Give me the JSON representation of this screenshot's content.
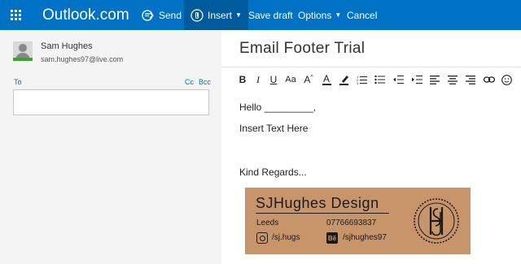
{
  "topbar": {
    "brand": "Outlook.com",
    "send_label": "Send",
    "insert_label": "Insert",
    "save_draft_label": "Save draft",
    "options_label": "Options",
    "cancel_label": "Cancel",
    "accent": "#0072c6"
  },
  "sender": {
    "name": "Sam Hughes",
    "email": "sam.hughes97@live.com"
  },
  "recipients": {
    "to_label": "To",
    "cc_label": "Cc",
    "bcc_label": "Bcc",
    "to_value": ""
  },
  "message": {
    "subject": "Email Footer Trial",
    "lines": [
      "Hello _________,",
      "Insert Text Here",
      "Kind Regards..."
    ]
  },
  "toolbar": {
    "bold": "B",
    "italic": "I",
    "underline": "U",
    "font_size": "Aa",
    "grow": "A",
    "font_color": "A"
  },
  "signature": {
    "title": "SJHughes Design",
    "city": "Leeds",
    "phone": "07766693837",
    "instagram": "/sj.hugs",
    "behance": "/sjhughes97",
    "behance_icon_text": "Bē",
    "seal_text": "SJH",
    "card_color": "#c8946a"
  }
}
